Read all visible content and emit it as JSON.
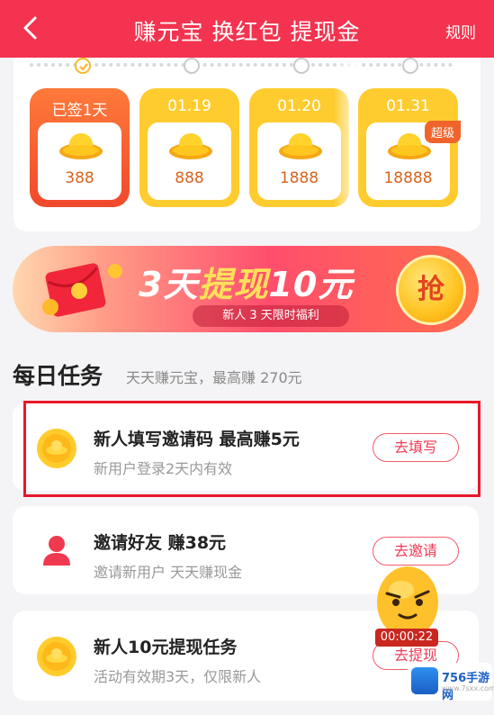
{
  "header": {
    "title": "赚元宝 换红包 提现金",
    "rules_label": "规则"
  },
  "signin": {
    "days": [
      {
        "label": "已签1天",
        "amount": "388",
        "signed": true
      },
      {
        "label": "01.19",
        "amount": "888"
      },
      {
        "label": "01.20",
        "amount": "1888"
      },
      {
        "label": "01.31",
        "amount": "18888",
        "badge": "超级"
      }
    ]
  },
  "banner": {
    "title_a": "3天",
    "title_b": "提现",
    "title_c": "10元",
    "subtitle": "新人 3 天限时福利",
    "button": "抢"
  },
  "daily": {
    "title": "每日任务",
    "subtitle": "天天赚元宝，最高赚 270元"
  },
  "tasks": [
    {
      "title": "新人填写邀请码 最高赚5元",
      "desc": "新用户登录2天内有效",
      "button": "去填写",
      "icon": "gold-coin-icon"
    },
    {
      "title": "邀请好友 赚38元",
      "desc": "邀请新用户 天天赚现金",
      "button": "去邀请",
      "icon": "user-icon"
    },
    {
      "title": "新人10元提现任务",
      "desc": "活动有效期3天，仅限新人",
      "button": "去提现",
      "icon": "gold-coin-icon"
    }
  ],
  "timer": "00:00:22",
  "watermark": {
    "name": "756手游网",
    "url": "www.7sxx.com"
  },
  "colors": {
    "primary": "#f3334f",
    "gold": "#ffcc2f",
    "highlight": "#e8182a"
  }
}
